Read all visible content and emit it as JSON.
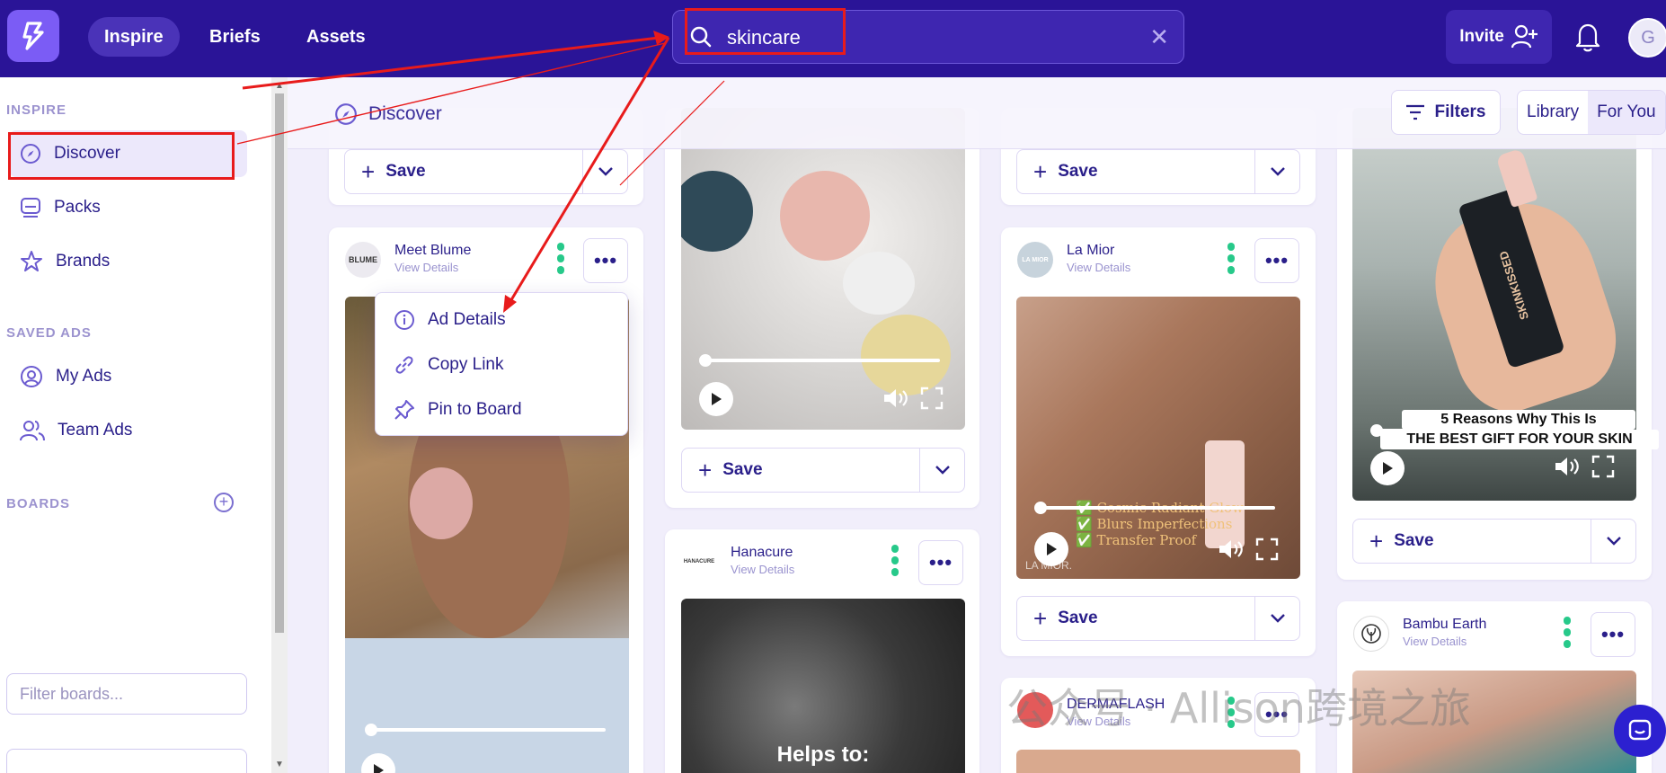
{
  "topbar": {
    "nav": [
      "Inspire",
      "Briefs",
      "Assets"
    ],
    "search_value": "skincare",
    "invite_label": "Invite",
    "avatar_initial": "G"
  },
  "sidebar": {
    "inspire_title": "INSPIRE",
    "items": [
      {
        "label": "Discover"
      },
      {
        "label": "Packs"
      },
      {
        "label": "Brands"
      }
    ],
    "saved_title": "SAVED ADS",
    "saved_items": [
      {
        "label": "My Ads"
      },
      {
        "label": "Team Ads"
      }
    ],
    "boards_title": "BOARDS",
    "filter_placeholder": "Filter boards..."
  },
  "header": {
    "title": "Discover",
    "filters_label": "Filters",
    "library_label": "Library",
    "for_you_label": "For You"
  },
  "cards": {
    "save_label": "Save",
    "view_details": "View Details",
    "brands": [
      "Meet Blume",
      "Hanacure",
      "La Mior",
      "DERMAFLASH",
      "Bambu Earth"
    ],
    "logo_texts": [
      "BLUME",
      "HANACURE",
      "LA MIOR"
    ]
  },
  "menu": {
    "items": [
      "Ad Details",
      "Copy Link",
      "Pin to Board"
    ]
  },
  "media_text": {
    "skinkissed_line1": "5 Reasons Why This Is",
    "skinkissed_line2": "THE BEST GIFT FOR YOUR SKIN",
    "lamior_checks": [
      "Cosmic Radiant Glow",
      "Blurs Imperfections",
      "Transfer Proof"
    ],
    "lamior_mark": "LA MIOR.",
    "hanacure_text": "Helps to:",
    "bottle_text": "SKINKISSED"
  },
  "watermark": "公众号 · Allison跨境之旅",
  "colors": {
    "topbar": "#2a1497",
    "accent": "#7b5cf5",
    "highlight": "#e81b1b",
    "green": "#27c98a"
  }
}
